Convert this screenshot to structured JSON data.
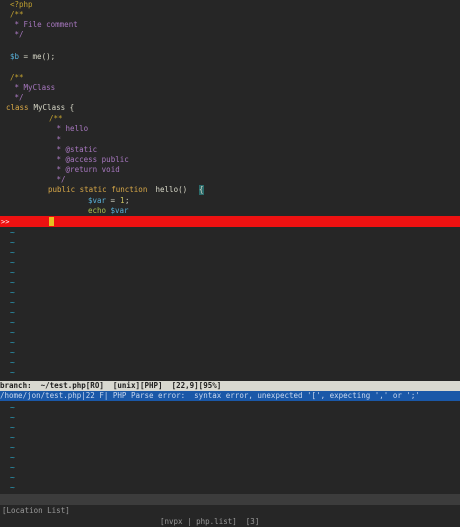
{
  "editor": {
    "lines": {
      "l1": "<?php",
      "l2": "/**",
      "l3": " * File comment",
      "l4": " */",
      "l6a": "$b",
      "l6b": " = me();",
      "l8": "/**",
      "l9": " * MyClass",
      "l10": " */",
      "l11a": "class",
      "l11b": " MyClass {",
      "l12": "/**",
      "l13": " * hello",
      "l14": " *",
      "l15": " * @static",
      "l16": " * @access public",
      "l17": " * @return void",
      "l18": " */",
      "l19a": "public static function",
      "l19b": " hello() ",
      "l19c": "{",
      "l20a": "$var",
      "l20b": " = ",
      "l20c": "1",
      "l20d": ";",
      "l21a": "echo",
      "l21b": " $var"
    },
    "error_sign": ">>",
    "tilde": "~"
  },
  "statusline": {
    "text": "branch:  ~/test.php[RO]  [unix][PHP]  [22,9][95%]"
  },
  "quickfix": {
    "text": "/home/jon/test.php|22 F| PHP Parse error:  syntax error, unexpected '[', expecting ',' or ';'"
  },
  "bottom_status": {
    "left": "[Location List]  ",
    "right": "[nvpx | php.list]  [3]"
  },
  "colors": {
    "background": "#262626",
    "error_line": "#ee1111",
    "statusline": "#d8d8d0",
    "quickfix": "#1a58a8",
    "tilde": "#2aa8c8"
  }
}
